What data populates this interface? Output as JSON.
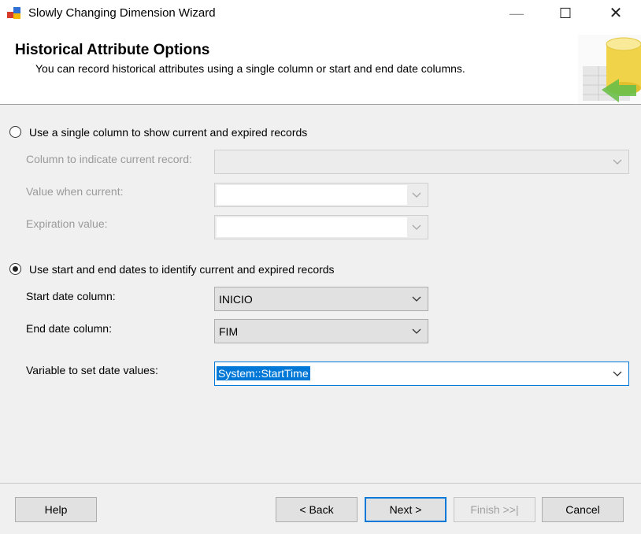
{
  "window": {
    "title": "Slowly Changing Dimension Wizard",
    "minimize_glyph": "—",
    "maximize_glyph": "☐",
    "close_glyph": "✕"
  },
  "header": {
    "title": "Historical Attribute Options",
    "subtitle": "You can record historical attributes using a single column or start and end date columns."
  },
  "single_column": {
    "label": "Use a single column to show current and expired records",
    "selected": false,
    "current_record_label": "Column to indicate current record:",
    "current_record_value": "",
    "value_when_current_label": "Value when current:",
    "value_when_current_value": "",
    "expiration_label": "Expiration value:",
    "expiration_value": ""
  },
  "date_columns": {
    "label": "Use start and end dates to identify current and expired records",
    "selected": true,
    "start_label": "Start date column:",
    "start_value": "INICIO",
    "end_label": "End date column:",
    "end_value": "FIM",
    "variable_label": "Variable to set date values:",
    "variable_value": "System::StartTime"
  },
  "footer": {
    "help": "Help",
    "back": "< Back",
    "next": "Next >",
    "finish": "Finish >>|",
    "cancel": "Cancel"
  },
  "colors": {
    "accent": "#0078d7",
    "panel": "#f0f0f0"
  }
}
